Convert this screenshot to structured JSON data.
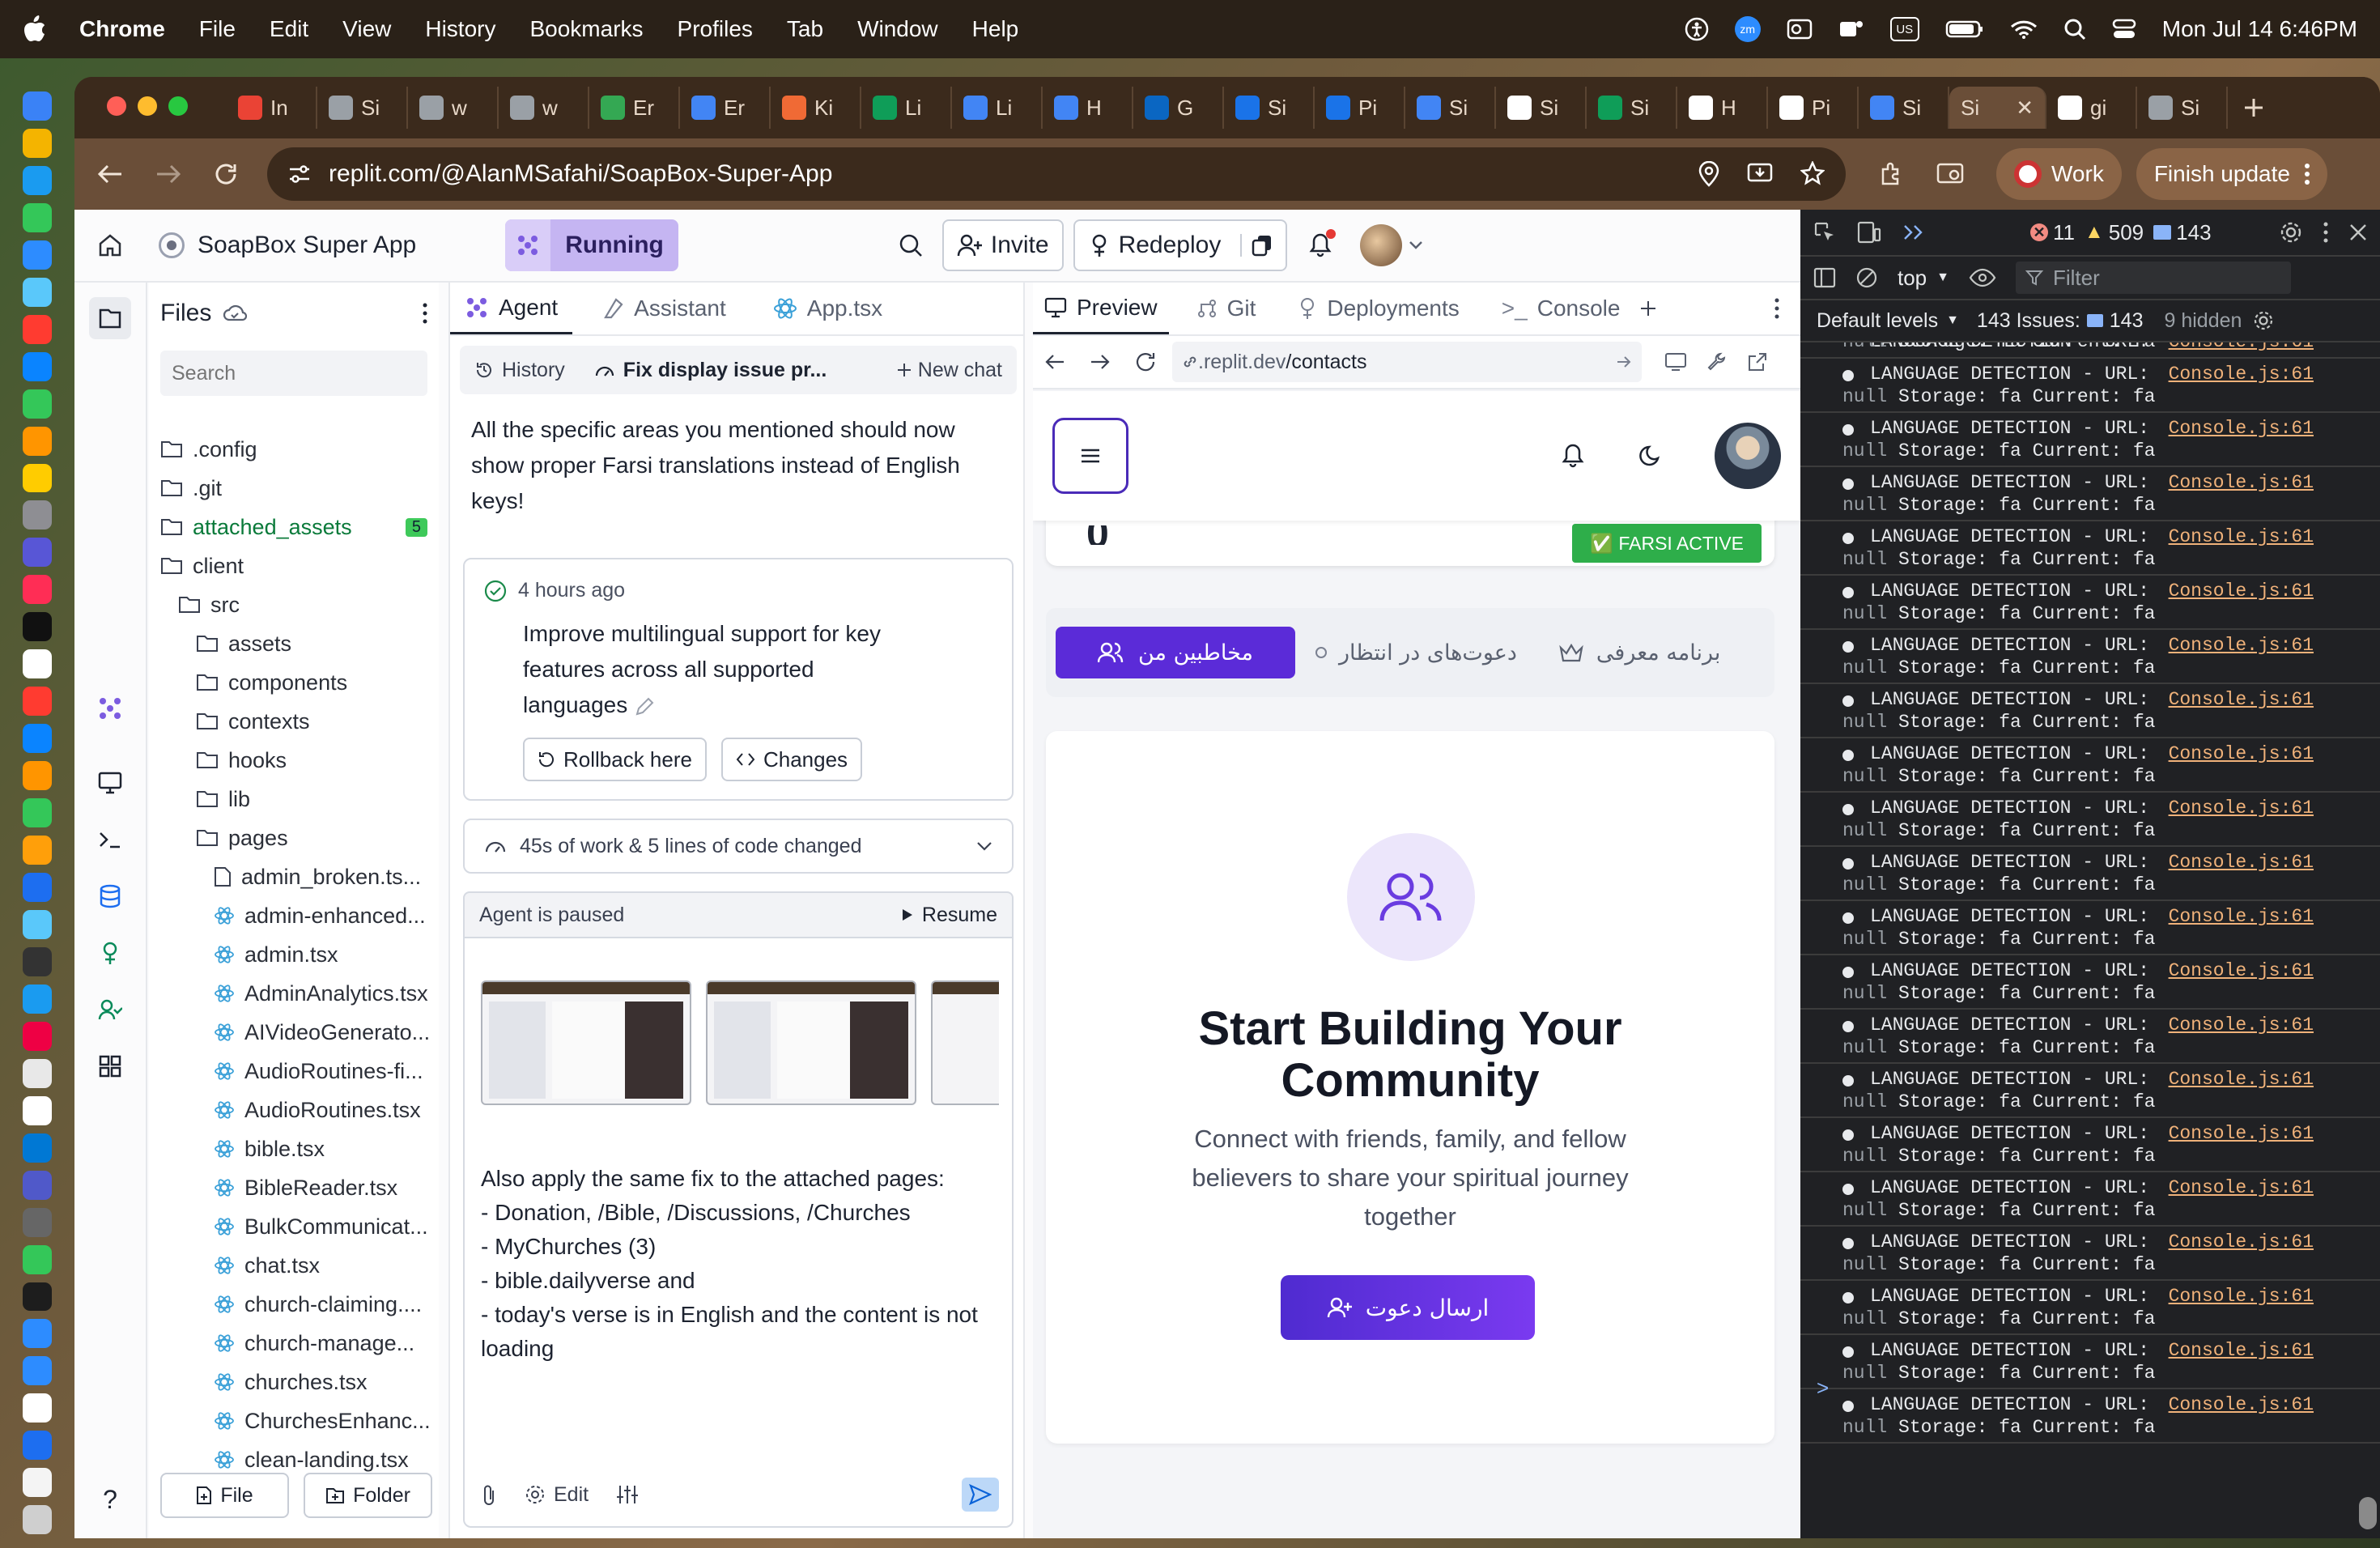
{
  "menubar": {
    "app": "Chrome",
    "items": [
      "File",
      "Edit",
      "View",
      "History",
      "Bookmarks",
      "Profiles",
      "Tab",
      "Window",
      "Help"
    ],
    "tray": {
      "input_source": "US",
      "zm": "zm"
    },
    "clock": "Mon Jul 14  6:46PM"
  },
  "browser": {
    "tabs": [
      {
        "label": "In",
        "color": "#ea4335"
      },
      {
        "label": "Si",
        "color": "#9aa0a6"
      },
      {
        "label": "w",
        "color": "#9aa0a6"
      },
      {
        "label": "w",
        "color": "#9aa0a6"
      },
      {
        "label": "Er",
        "color": "#34a853"
      },
      {
        "label": "Er",
        "color": "#4285f4"
      },
      {
        "label": "Ki",
        "color": "#f06a35"
      },
      {
        "label": "Li",
        "color": "#0f9d58"
      },
      {
        "label": "Li",
        "color": "#4285f4"
      },
      {
        "label": "H",
        "color": "#4285f4"
      },
      {
        "label": "G",
        "color": "#0a66c2"
      },
      {
        "label": "Si",
        "color": "#1a73e8"
      },
      {
        "label": "Pi",
        "color": "#1a73e8"
      },
      {
        "label": "Si",
        "color": "#4285f4"
      },
      {
        "label": "Si",
        "color": "#ffffff"
      },
      {
        "label": "Si",
        "color": "#0f9d58"
      },
      {
        "label": "H",
        "color": "#ffffff"
      },
      {
        "label": "Pi",
        "color": "#ffffff"
      },
      {
        "label": "Si",
        "color": "#4285f4"
      },
      {
        "label": "Si",
        "color": "#f2b33d"
      },
      {
        "label": "gi",
        "color": "#ffffff"
      },
      {
        "label": "Si",
        "color": "#9aa0a6"
      }
    ],
    "url": "replit.com/@AlanMSafahi/SoapBox-Super-App",
    "profile": "Work",
    "update": "Finish update"
  },
  "replit": {
    "project": "SoapBox Super App",
    "status": "Running",
    "invite": "Invite",
    "redeploy": "Redeploy"
  },
  "files": {
    "title": "Files",
    "search_placeholder": "Search",
    "tree": [
      {
        "name": ".config",
        "type": "folder",
        "depth": 0
      },
      {
        "name": ".git",
        "type": "folder",
        "depth": 0
      },
      {
        "name": "attached_assets",
        "type": "folder",
        "depth": 0,
        "badge": "5"
      },
      {
        "name": "client",
        "type": "folder",
        "depth": 0
      },
      {
        "name": "src",
        "type": "folder",
        "depth": 1
      },
      {
        "name": "assets",
        "type": "folder",
        "depth": 2
      },
      {
        "name": "components",
        "type": "folder",
        "depth": 2
      },
      {
        "name": "contexts",
        "type": "folder",
        "depth": 2
      },
      {
        "name": "hooks",
        "type": "folder",
        "depth": 2
      },
      {
        "name": "lib",
        "type": "folder",
        "depth": 2
      },
      {
        "name": "pages",
        "type": "folder",
        "depth": 2
      },
      {
        "name": "admin_broken.ts...",
        "type": "file",
        "depth": 3
      },
      {
        "name": "admin-enhanced...",
        "type": "react",
        "depth": 3
      },
      {
        "name": "admin.tsx",
        "type": "react",
        "depth": 3
      },
      {
        "name": "AdminAnalytics.tsx",
        "type": "react",
        "depth": 3
      },
      {
        "name": "AIVideoGenerato...",
        "type": "react",
        "depth": 3
      },
      {
        "name": "AudioRoutines-fi...",
        "type": "react",
        "depth": 3
      },
      {
        "name": "AudioRoutines.tsx",
        "type": "react",
        "depth": 3
      },
      {
        "name": "bible.tsx",
        "type": "react",
        "depth": 3
      },
      {
        "name": "BibleReader.tsx",
        "type": "react",
        "depth": 3
      },
      {
        "name": "BulkCommunicat...",
        "type": "react",
        "depth": 3
      },
      {
        "name": "chat.tsx",
        "type": "react",
        "depth": 3
      },
      {
        "name": "church-claiming....",
        "type": "react",
        "depth": 3
      },
      {
        "name": "church-manage...",
        "type": "react",
        "depth": 3
      },
      {
        "name": "churches.tsx",
        "type": "react",
        "depth": 3
      },
      {
        "name": "ChurchesEnhanc...",
        "type": "react",
        "depth": 3
      },
      {
        "name": "clean-landing.tsx",
        "type": "react",
        "depth": 3
      }
    ],
    "new_file": "File",
    "new_folder": "Folder"
  },
  "agent": {
    "tabs": [
      "Agent",
      "Assistant",
      "App.tsx"
    ],
    "history": "History",
    "chat_title": "Fix display issue pr...",
    "new_chat": "New chat",
    "message": "All the specific areas you mentioned should now show proper Farsi translations instead of English keys!",
    "checkpoint": {
      "time": "4 hours ago",
      "text": "Improve multilingual support for key features across all supported languages",
      "rollback": "Rollback here",
      "changes": "Changes"
    },
    "work_summary": "45s of work & 5 lines of code changed",
    "paused": "Agent is paused",
    "resume": "Resume",
    "input_text": "Also apply the same fix to the attached pages:\n- Donation, /Bible, /Discussions, /Churches\n- MyChurches (3)\n- bible.dailyverse and\n- today's verse is in English and the content is not loading",
    "edit": "Edit"
  },
  "preview": {
    "tabs": [
      "Preview",
      "Git",
      "Deployments",
      "Console"
    ],
    "url_prefix": ".replit.dev",
    "url_path": "/contacts",
    "stat_digit": "0",
    "farsi_badge": "✅ FARSI ACTIVE",
    "segments": [
      "مخاطبین من",
      "دعوت‌های در انتظار",
      "برنامه معرفی"
    ],
    "title": "Start Building Your Community",
    "subtitle": "Connect with friends, family, and fellow believers to share your spiritual journey together",
    "cta": "ارسال دعوت"
  },
  "devtools": {
    "errors": "11",
    "warnings": "509",
    "messages": "143",
    "context": "top",
    "filter_placeholder": "Filter",
    "levels": "Default levels",
    "issues_label": "143 Issues:",
    "issues_count": "143",
    "hidden": "9 hidden",
    "log_line1": "LANGUAGE DETECTION - URL:",
    "log_null": "null",
    "log_line2": " Storage: fa Current: fa",
    "log_source": "Console.js:61",
    "log_count": 21,
    "prompt": ">"
  }
}
